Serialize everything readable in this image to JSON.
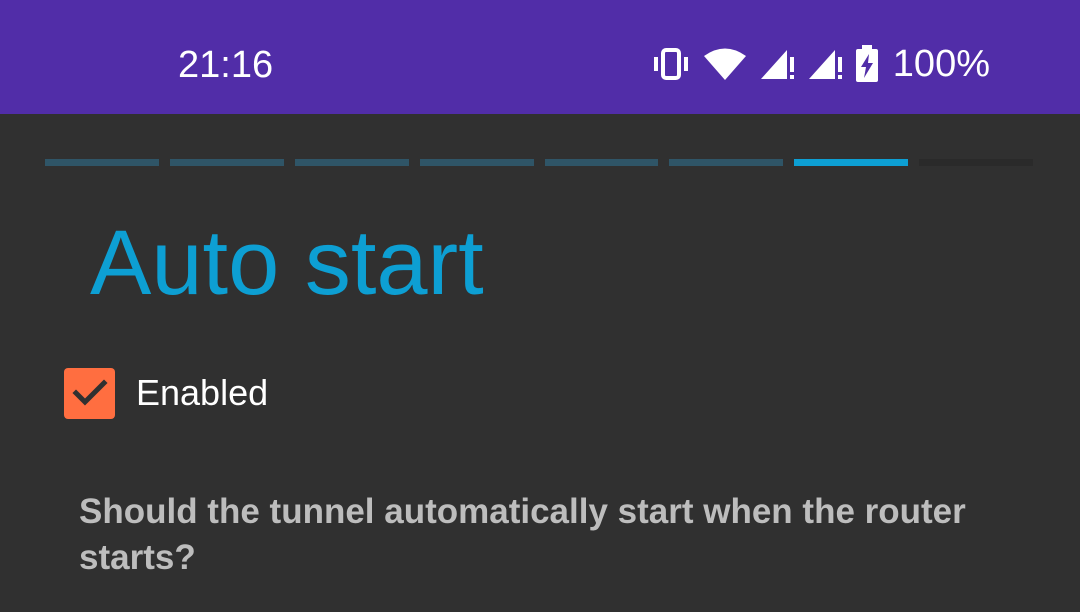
{
  "status_bar": {
    "time": "21:16",
    "battery_percent": "100%",
    "icons": [
      "vibrate-icon",
      "wifi-icon",
      "signal-icon",
      "signal-icon",
      "battery-charging-icon"
    ],
    "background_color": "#512DA8"
  },
  "wizard": {
    "step_count": 8,
    "current_step": 7,
    "accent_color": "#0d9fd3"
  },
  "page": {
    "title": "Auto start",
    "checkbox": {
      "label": "Enabled",
      "checked": true,
      "color": "#FF6E40"
    },
    "description": "Should the tunnel automatically start when the router starts?"
  }
}
